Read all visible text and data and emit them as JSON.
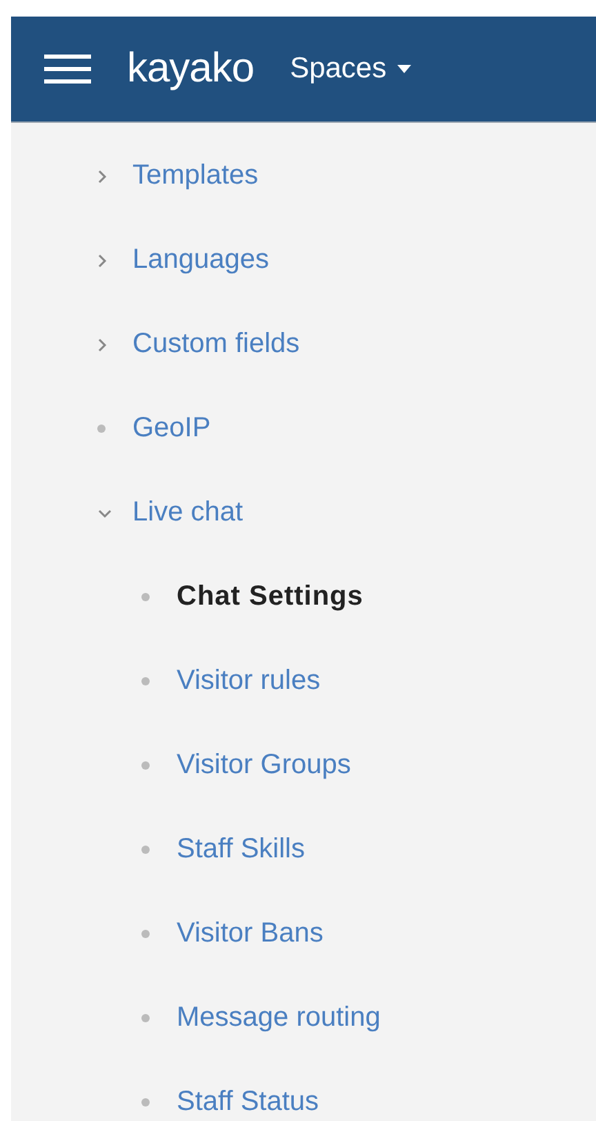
{
  "header": {
    "logo": "kayako",
    "spaces_menu": "Spaces"
  },
  "nav": [
    {
      "label": "Templates",
      "kind": "collapsed",
      "selected": false
    },
    {
      "label": "Languages",
      "kind": "collapsed",
      "selected": false
    },
    {
      "label": "Custom fields",
      "kind": "collapsed",
      "selected": false
    },
    {
      "label": "GeoIP",
      "kind": "leaf",
      "selected": false
    },
    {
      "label": "Live chat",
      "kind": "expanded",
      "selected": false,
      "children": [
        {
          "label": "Chat Settings",
          "kind": "leaf",
          "selected": true
        },
        {
          "label": "Visitor rules",
          "kind": "leaf",
          "selected": false
        },
        {
          "label": "Visitor Groups",
          "kind": "leaf",
          "selected": false
        },
        {
          "label": "Staff Skills",
          "kind": "leaf",
          "selected": false
        },
        {
          "label": "Visitor Bans",
          "kind": "leaf",
          "selected": false
        },
        {
          "label": "Message routing",
          "kind": "leaf",
          "selected": false
        },
        {
          "label": "Staff Status",
          "kind": "leaf",
          "selected": false
        }
      ]
    }
  ]
}
